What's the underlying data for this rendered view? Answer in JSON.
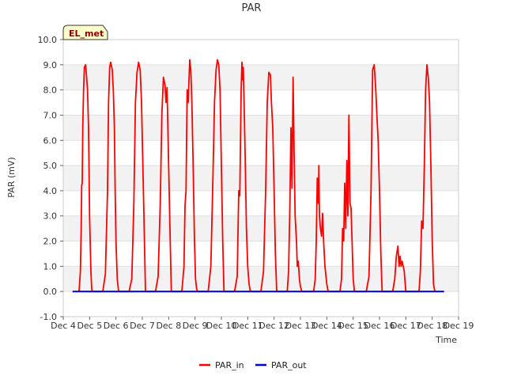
{
  "chart_data": {
    "type": "line",
    "title": "PAR",
    "xlabel": "Time",
    "ylabel": "PAR (mV)",
    "badge": "EL_met",
    "xlim": [
      4,
      19
    ],
    "ylim": [
      -1.0,
      10.0
    ],
    "x_ticks": [
      4,
      5,
      6,
      7,
      8,
      9,
      10,
      11,
      12,
      13,
      14,
      15,
      16,
      17,
      18,
      19
    ],
    "x_tick_labels": [
      "Dec 4",
      "Dec 5",
      "Dec 6",
      "Dec 7",
      "Dec 8",
      "Dec 9",
      "Dec 10",
      "Dec 11",
      "Dec 12",
      "Dec 13",
      "Dec 14",
      "Dec 15",
      "Dec 16",
      "Dec 17",
      "Dec 18",
      "Dec 19"
    ],
    "y_ticks": [
      -1.0,
      0.0,
      1.0,
      2.0,
      3.0,
      4.0,
      5.0,
      6.0,
      7.0,
      8.0,
      9.0,
      10.0
    ],
    "y_tick_labels": [
      "-1.0",
      "0.0",
      "1.0",
      "2.0",
      "3.0",
      "4.0",
      "5.0",
      "6.0",
      "7.0",
      "8.0",
      "9.0",
      "10.0"
    ],
    "grid": "horizontal bands",
    "legend_position": "bottom-center",
    "series": [
      {
        "name": "PAR_in",
        "color": "#ff0000",
        "x": [
          4.6,
          4.65,
          4.68,
          4.7,
          4.72,
          4.74,
          4.77,
          4.8,
          4.85,
          4.88,
          4.92,
          4.96,
          5.0,
          5.05,
          5.08,
          5.1,
          5.5,
          5.6,
          5.68,
          5.72,
          5.76,
          5.8,
          5.86,
          5.9,
          5.94,
          5.97,
          6.0,
          6.05,
          6.1,
          6.5,
          6.6,
          6.68,
          6.74,
          6.8,
          6.86,
          6.92,
          6.97,
          7.02,
          7.08,
          7.12,
          7.5,
          7.6,
          7.68,
          7.74,
          7.8,
          7.86,
          7.9,
          7.94,
          8.0,
          8.06,
          8.1,
          8.5,
          8.58,
          8.62,
          8.66,
          8.7,
          8.74,
          8.8,
          8.84,
          8.88,
          8.93,
          8.98,
          9.02,
          9.06,
          9.1,
          9.5,
          9.6,
          9.68,
          9.74,
          9.8,
          9.85,
          9.9,
          9.95,
          10.0,
          10.05,
          10.1,
          10.5,
          10.6,
          10.66,
          10.7,
          10.75,
          10.78,
          10.8,
          10.83,
          10.86,
          10.9,
          10.95,
          11.0,
          11.05,
          11.1,
          11.5,
          11.6,
          11.68,
          11.74,
          11.8,
          11.86,
          11.9,
          11.95,
          12.0,
          12.05,
          12.1,
          12.5,
          12.55,
          12.6,
          12.64,
          12.68,
          12.72,
          12.76,
          12.8,
          12.85,
          12.88,
          12.92,
          12.96,
          13.0,
          13.05,
          13.1,
          13.5,
          13.56,
          13.6,
          13.64,
          13.68,
          13.7,
          13.72,
          13.76,
          13.8,
          13.84,
          13.88,
          13.93,
          14.0,
          14.05,
          14.1,
          14.5,
          14.56,
          14.6,
          14.64,
          14.68,
          14.72,
          14.76,
          14.8,
          14.84,
          14.88,
          14.92,
          14.96,
          15.0,
          15.05,
          15.1,
          15.5,
          15.6,
          15.68,
          15.74,
          15.8,
          15.86,
          15.9,
          15.95,
          16.0,
          16.05,
          16.1,
          16.5,
          16.58,
          16.64,
          16.7,
          16.74,
          16.78,
          16.82,
          16.86,
          16.9,
          16.94,
          17.0,
          17.05,
          17.1,
          17.5,
          17.55,
          17.6,
          17.65,
          17.7,
          17.75,
          17.8,
          17.85,
          17.9,
          17.95,
          18.0,
          18.05,
          18.1
        ],
        "y": [
          0.0,
          0.8,
          2.5,
          4.2,
          4.3,
          6.5,
          8.0,
          8.9,
          9.0,
          8.6,
          8.0,
          6.5,
          3.0,
          0.8,
          0.1,
          0.0,
          0.0,
          0.7,
          4.0,
          7.5,
          8.9,
          9.1,
          8.8,
          8.0,
          6.5,
          3.9,
          2.0,
          0.5,
          0.0,
          0.0,
          0.5,
          3.5,
          7.5,
          8.7,
          9.1,
          8.8,
          7.5,
          5.0,
          2.0,
          0.0,
          0.0,
          0.6,
          3.5,
          7.0,
          8.5,
          8.2,
          7.5,
          8.1,
          5.0,
          2.0,
          0.0,
          0.0,
          1.0,
          3.4,
          4.0,
          8.0,
          7.5,
          9.2,
          8.8,
          7.5,
          5.0,
          2.0,
          0.5,
          0.1,
          0.0,
          0.0,
          1.0,
          4.5,
          7.5,
          8.8,
          9.2,
          9.0,
          8.0,
          5.0,
          2.0,
          0.0,
          0.0,
          0.6,
          4.0,
          3.8,
          8.0,
          9.1,
          8.4,
          8.9,
          7.5,
          5.5,
          2.5,
          1.0,
          0.3,
          0.0,
          0.0,
          0.8,
          4.0,
          7.5,
          8.7,
          8.6,
          7.5,
          6.5,
          4.0,
          1.5,
          0.0,
          0.0,
          0.8,
          3.5,
          6.5,
          4.1,
          8.5,
          5.5,
          3.0,
          2.0,
          1.0,
          1.2,
          0.5,
          0.2,
          0.0,
          0.0,
          0.0,
          0.5,
          2.0,
          4.5,
          3.5,
          5.0,
          3.0,
          2.5,
          2.2,
          3.1,
          2.0,
          1.0,
          0.3,
          0.0,
          0.0,
          0.0,
          0.5,
          2.5,
          2.0,
          4.3,
          2.5,
          5.2,
          3.0,
          7.0,
          3.5,
          3.3,
          2.0,
          0.5,
          0.0,
          0.0,
          0.0,
          0.6,
          4.0,
          8.8,
          9.0,
          8.0,
          7.0,
          6.0,
          4.0,
          1.5,
          0.0,
          0.0,
          0.5,
          1.4,
          1.8,
          1.0,
          1.4,
          1.0,
          1.2,
          1.0,
          0.8,
          0.0,
          0.0,
          0.0,
          0.0,
          0.8,
          2.8,
          2.5,
          5.0,
          8.0,
          9.0,
          8.5,
          7.5,
          5.0,
          2.0,
          0.3,
          0.0
        ]
      },
      {
        "name": "PAR_out",
        "color": "#0000cd",
        "x": [
          4.35,
          18.45
        ],
        "y": [
          0.0,
          0.0
        ]
      }
    ]
  }
}
